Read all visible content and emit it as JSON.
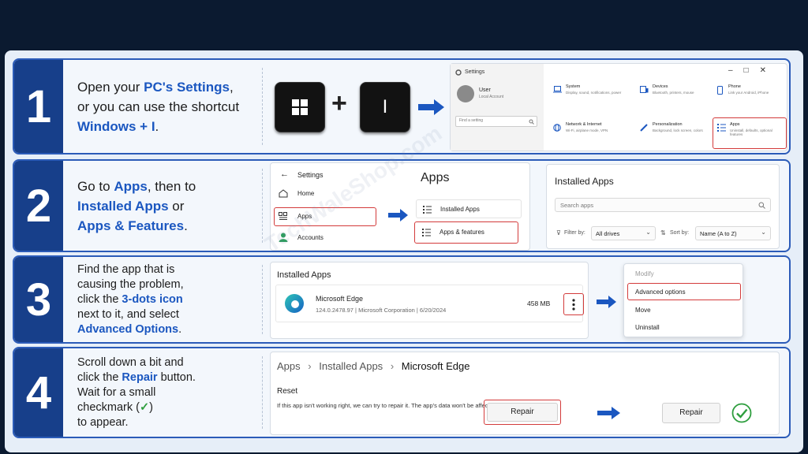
{
  "steps": [
    {
      "number": "1",
      "text_parts": [
        "Open your ",
        "PC's Settings",
        ",",
        "or you can use the shortcut",
        "Windows + I",
        "."
      ],
      "keys": {
        "win_icon": "windows-logo",
        "plus": "+",
        "i_key": "I"
      },
      "settings": {
        "window_title": "Settings",
        "user_name": "User",
        "user_sub": "Local Account",
        "search_placeholder": "Find a setting",
        "tiles": [
          {
            "icon": "laptop-icon",
            "name": "System",
            "desc": "Display, sound, notifications, power"
          },
          {
            "icon": "devices-icon",
            "name": "Devices",
            "desc": "Bluetooth, printers, mouse"
          },
          {
            "icon": "phone-icon",
            "name": "Phone",
            "desc": "Link your Android, iPhone"
          },
          {
            "icon": "globe-icon",
            "name": "Network & Internet",
            "desc": "Wi-Fi, airplane mode, VPN"
          },
          {
            "icon": "brush-icon",
            "name": "Personalization",
            "desc": "Background, lock screen, colors"
          },
          {
            "icon": "apps-list-icon",
            "name": "Apps",
            "desc": "Uninstall, defaults, optional features"
          }
        ]
      }
    },
    {
      "number": "2",
      "text_parts": [
        "Go to ",
        "Apps",
        ", then to",
        "Installed Apps",
        " or",
        "Apps & Features",
        "."
      ],
      "nav": {
        "back_label": "Settings",
        "items": [
          "Home",
          "Apps",
          "Accounts"
        ]
      },
      "apps_menu": {
        "title": "Apps",
        "items": [
          "Installed Apps",
          "Apps & features"
        ]
      },
      "installed": {
        "title": "Installed Apps",
        "search_placeholder": "Search apps",
        "filter_label": "Filter by:",
        "filter_value": "All drives",
        "sort_label": "Sort by:",
        "sort_value": "Name (A to Z)"
      }
    },
    {
      "number": "3",
      "text_parts": [
        "Find the app that is",
        "causing the problem,",
        "click the ",
        "3-dots icon",
        "next to it, and select",
        "Advanced Options",
        "."
      ],
      "card_title": "Installed Apps",
      "app": {
        "name": "Microsoft Edge",
        "version": "124.0.2478.97",
        "publisher": "Microsoft Corporation",
        "date": "6/20/2024",
        "size": "458 MB"
      },
      "context_menu": [
        "Modify",
        "Advanced options",
        "Move",
        "Uninstall"
      ]
    },
    {
      "number": "4",
      "text_parts": [
        "Scroll down a bit and",
        "click the ",
        "Repair",
        " button.",
        "Wait for a small",
        "checkmark (",
        "✓",
        ")",
        "to appear."
      ],
      "breadcrumb": [
        "Apps",
        "Installed Apps",
        "Microsoft Edge"
      ],
      "reset_title": "Reset",
      "reset_desc": "If this app isn't working right, we can try to repair it. The app's data won't be affected.",
      "repair_label": "Repair",
      "repair_done_label": "Repair"
    }
  ],
  "watermark": "TechWaleShop.com",
  "colors": {
    "accent": "#1b57c0",
    "number_bg": "#173f8a",
    "highlight_red": "#d33b3b",
    "success_green": "#2e9e3e"
  }
}
